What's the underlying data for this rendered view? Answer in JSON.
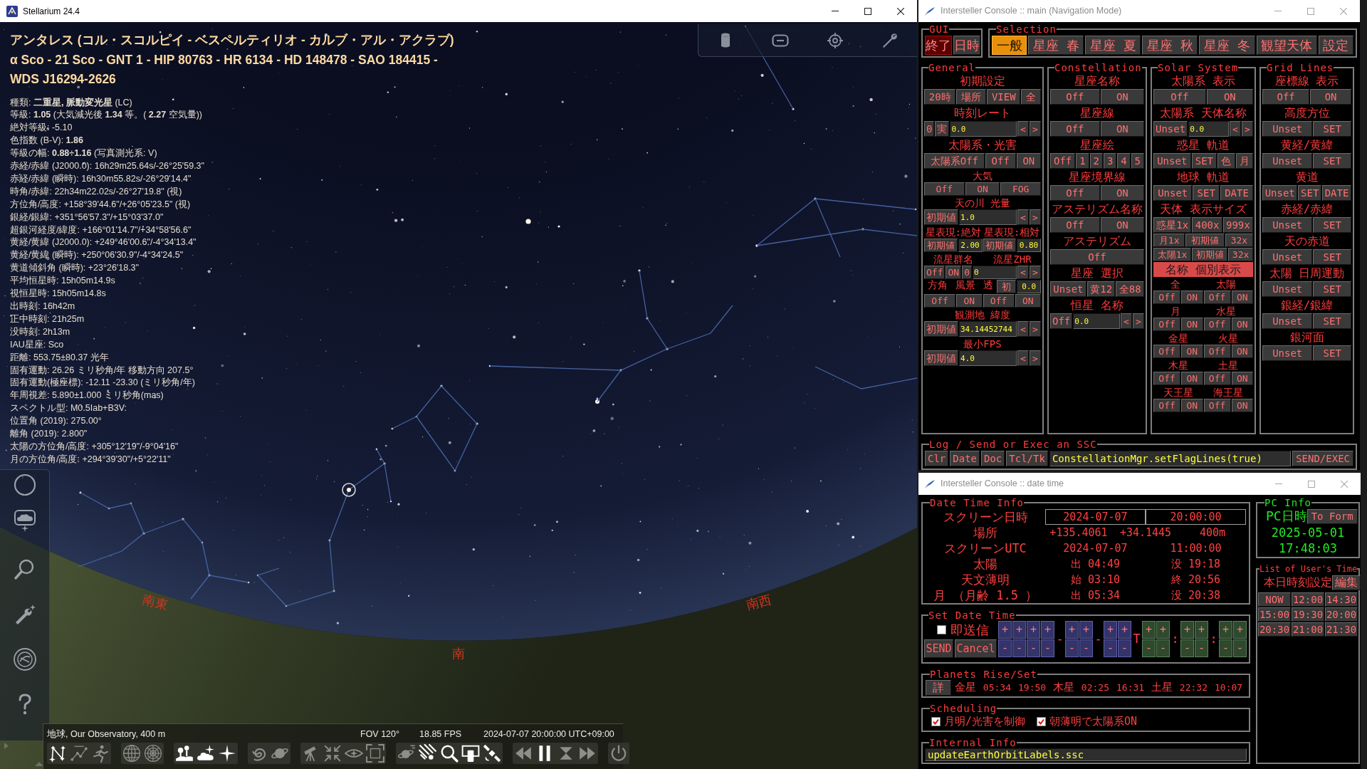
{
  "stellarium": {
    "window": {
      "title": "Stellarium 24.4"
    },
    "info": {
      "title_lines": [
        "アンタレス (コル・スコルピイ - ベスペルティリオ - カルブ・アル・アクラブ)",
        "α Sco - 21 Sco - GNT 1 - HIP 80763 - HR 6134 - HD 148478 - SAO 184415 -",
        "WDS J16294-2626"
      ],
      "lines": [
        "種類: **二重星, 脈動変光星** (LC)",
        "等級: **1.05** (大気減光後 **1.34** 等。( **2.27** 空気量))",
        "絶対等級: -5.10",
        "色指数 (B-V): **1.86**",
        "等級の幅: **0.88÷1.16** (写真測光系: V)",
        "赤経/赤緯 (J2000.0): 16h29m25.64s/-26°25'59.3\"",
        "赤経/赤緯 (瞬時): 16h30m55.82s/-26°29'14.4\"",
        "時角/赤緯: 22h34m22.02s/-26°27'19.8\" (視)",
        "方位角/高度: +158°39'44.6\"/+26°05'23.5\" (視)",
        "銀経/銀緯: +351°56'57.3\"/+15°03'37.0\"",
        "超銀河経度/緯度: +166°01'14.7\"/+34°58'56.6\"",
        "黄経/黄緯 (J2000.0): +249°46'00.6\"/-4°34'13.4\"",
        "黄経/黄緯 (瞬時): +250°06'30.9\"/-4°34'24.5\"",
        "黄道傾斜角 (瞬時): +23°26'18.3\"",
        "平均恒星時: 15h05m14.9s",
        "視恒星時: 15h05m14.8s",
        "出時刻: 16h42m",
        "正中時刻: 21h25m",
        "没時刻: 2h13m",
        "IAU星座: Sco",
        "距離: 553.75±80.37 光年",
        "固有運動: 26.26 ミリ秒角/年 移動方向 207.5°",
        "固有運動(極座標): -12.11 -23.30 (ミリ秒角/年)",
        "年周視差: 5.890±1.000 ミリ秒角(mas)",
        "スペクトル型: M0.5Iab+B3V:",
        "位置角 (2019): 275.00°",
        "離角 (2019): 2.800\"",
        "太陽の方位角/高度: +305°12'19\"/-9°04'16\"",
        "月の方位角/高度: +294°39'30\"/+5°22'11\""
      ]
    },
    "directions": [
      "南東",
      "南",
      "南西"
    ],
    "status": {
      "location": "地球, Our Observatory, 400 m",
      "fov": "FOV 120°",
      "fps": "18.85 FPS",
      "datetime": "2024-07-07 20:00:00 UTC+09:00"
    },
    "toolbar": [
      {
        "buttons": [
          {
            "kind": "lines",
            "on": true
          },
          {
            "kind": "labels",
            "on": false
          },
          {
            "kind": "art",
            "on": false
          }
        ]
      },
      {
        "buttons": [
          {
            "kind": "equatorial",
            "on": false
          },
          {
            "kind": "azimuthal",
            "on": false
          }
        ]
      },
      {
        "buttons": [
          {
            "kind": "ground",
            "on": true
          },
          {
            "kind": "atmosphere",
            "on": true
          },
          {
            "kind": "stars",
            "on": true
          }
        ]
      },
      {
        "buttons": [
          {
            "kind": "nebulae",
            "on": false
          },
          {
            "kind": "planets",
            "on": false
          }
        ]
      },
      {
        "buttons": [
          {
            "kind": "mount",
            "on": false
          },
          {
            "kind": "center",
            "on": false
          },
          {
            "kind": "night",
            "on": false
          },
          {
            "kind": "fullscreen",
            "on": false
          }
        ]
      },
      {
        "buttons": [
          {
            "kind": "planetlabels",
            "on": false
          },
          {
            "kind": "meteors",
            "on": true
          },
          {
            "kind": "search",
            "on": true
          },
          {
            "kind": "remote",
            "on": true
          },
          {
            "kind": "satellites",
            "on": true
          }
        ]
      },
      {
        "buttons": [
          {
            "kind": "rewind",
            "on": false
          },
          {
            "kind": "pause",
            "on": true
          },
          {
            "kind": "realtime",
            "on": false
          },
          {
            "kind": "forward",
            "on": false
          }
        ]
      },
      {
        "buttons": [
          {
            "kind": "quit",
            "on": false
          }
        ]
      }
    ]
  },
  "console_main": {
    "title": "Intersteller Console :: main (Navigation Mode)",
    "gui": {
      "legend": "GUI",
      "buttons": [
        {
          "kind": "exit",
          "text": "終了"
        },
        {
          "kind": "normal",
          "text": "日時"
        }
      ]
    },
    "selection": {
      "legend": "Selection",
      "tabs": [
        {
          "label": "一般",
          "selected": true
        },
        {
          "label": "星座 春",
          "selected": false
        },
        {
          "label": "星座 夏",
          "selected": false
        },
        {
          "label": "星座 秋",
          "selected": false
        },
        {
          "label": "星座 冬",
          "selected": false
        },
        {
          "label": "観望天体",
          "selected": false
        },
        {
          "label": "設定",
          "selected": false
        }
      ]
    },
    "panels": [
      {
        "legend": "General",
        "rows": [
          {
            "kind": "heading",
            "items": [
              {
                "kind": "label",
                "text": "初期設定"
              }
            ]
          },
          {
            "kind": "controls",
            "items": [
              {
                "kind": "button",
                "text": "20時"
              },
              {
                "kind": "button",
                "text": "場所"
              },
              {
                "kind": "button",
                "text": "VIEW"
              },
              {
                "kind": "button",
                "text": "全"
              }
            ]
          },
          {
            "kind": "heading",
            "items": [
              {
                "kind": "label",
                "text": "時刻レート"
              }
            ]
          },
          {
            "kind": "controls",
            "items": [
              {
                "kind": "button",
                "text": "0"
              },
              {
                "kind": "button",
                "text": "実"
              },
              {
                "kind": "field",
                "text": "0.0"
              },
              {
                "kind": "arrow",
                "text": "<"
              },
              {
                "kind": "arrow",
                "text": ">"
              }
            ]
          },
          {
            "kind": "heading",
            "items": [
              {
                "kind": "label",
                "text": "太陽系・光害"
              }
            ]
          },
          {
            "kind": "controls",
            "items": [
              {
                "kind": "button",
                "text": "太陽系Off"
              },
              {
                "kind": "button",
                "text": "Off"
              },
              {
                "kind": "button",
                "text": "ON"
              }
            ]
          },
          {
            "kind": "subheading",
            "items": [
              {
                "kind": "label",
                "text": "大気"
              }
            ]
          },
          {
            "kind": "small",
            "items": [
              {
                "kind": "button",
                "text": "Off"
              },
              {
                "kind": "button",
                "text": "ON"
              },
              {
                "kind": "button",
                "text": "FOG"
              }
            ]
          },
          {
            "kind": "subheading",
            "items": [
              {
                "kind": "label",
                "text": "天の川 光量"
              }
            ]
          },
          {
            "kind": "controls",
            "items": [
              {
                "kind": "button",
                "text": "初期値"
              },
              {
                "kind": "field",
                "text": "1.0"
              },
              {
                "kind": "arrow",
                "text": "<"
              },
              {
                "kind": "arrow",
                "text": ">"
              }
            ]
          },
          {
            "kind": "subheading",
            "items": [
              {
                "kind": "label",
                "text": "星表現:絶対"
              },
              {
                "kind": "label",
                "text": "星表現:相対"
              }
            ]
          },
          {
            "kind": "small",
            "items": [
              {
                "kind": "button",
                "text": "初期値"
              },
              {
                "kind": "value",
                "text": "2.00"
              },
              {
                "kind": "button",
                "text": "初期値"
              },
              {
                "kind": "value",
                "text": "0.80"
              }
            ]
          },
          {
            "kind": "subheading",
            "items": [
              {
                "kind": "label",
                "text": "流星群名"
              },
              {
                "kind": "label",
                "text": "流星ZHR"
              }
            ]
          },
          {
            "kind": "small",
            "items": [
              {
                "kind": "button",
                "text": "Off"
              },
              {
                "kind": "button",
                "text": "ON"
              },
              {
                "kind": "button",
                "text": "0"
              },
              {
                "kind": "field",
                "text": "0"
              },
              {
                "kind": "arrow",
                "text": "<"
              },
              {
                "kind": "arrow",
                "text": ">"
              }
            ]
          },
          {
            "kind": "small",
            "items": [
              {
                "kind": "label",
                "text": "方角"
              },
              {
                "kind": "label",
                "text": "風景"
              },
              {
                "kind": "label",
                "text": "透"
              },
              {
                "kind": "button",
                "text": "初"
              },
              {
                "kind": "value",
                "text": "0.0"
              }
            ]
          },
          {
            "kind": "small",
            "items": [
              {
                "kind": "button",
                "text": "Off"
              },
              {
                "kind": "button",
                "text": "ON"
              },
              {
                "kind": "button",
                "text": "Off"
              },
              {
                "kind": "button",
                "text": "ON"
              }
            ]
          },
          {
            "kind": "subheading",
            "items": [
              {
                "kind": "label",
                "text": "観測地 緯度"
              }
            ]
          },
          {
            "kind": "controls",
            "items": [
              {
                "kind": "button",
                "text": "初期値"
              },
              {
                "kind": "field",
                "text": "34.14452744"
              },
              {
                "kind": "arrow",
                "text": "<"
              },
              {
                "kind": "arrow",
                "text": ">"
              }
            ]
          },
          {
            "kind": "subheading",
            "items": [
              {
                "kind": "label",
                "text": "最小FPS"
              }
            ]
          },
          {
            "kind": "controls",
            "items": [
              {
                "kind": "button",
                "text": "初期値"
              },
              {
                "kind": "field",
                "text": "4.0"
              },
              {
                "kind": "arrow",
                "text": "<"
              },
              {
                "kind": "arrow",
                "text": ">"
              }
            ]
          }
        ]
      },
      {
        "legend": "Constellation",
        "rows": [
          {
            "kind": "heading",
            "items": [
              {
                "kind": "label",
                "text": "星座名称"
              }
            ]
          },
          {
            "kind": "controls",
            "items": [
              {
                "kind": "button",
                "text": "Off"
              },
              {
                "kind": "button",
                "text": "ON"
              }
            ]
          },
          {
            "kind": "heading",
            "items": [
              {
                "kind": "label",
                "text": "星座線"
              }
            ]
          },
          {
            "kind": "controls",
            "items": [
              {
                "kind": "button",
                "text": "Off"
              },
              {
                "kind": "button",
                "text": "ON"
              }
            ]
          },
          {
            "kind": "heading",
            "items": [
              {
                "kind": "label",
                "text": "星座絵"
              }
            ]
          },
          {
            "kind": "controls",
            "items": [
              {
                "kind": "button",
                "text": "Off"
              },
              {
                "kind": "button",
                "text": "1"
              },
              {
                "kind": "button",
                "text": "2"
              },
              {
                "kind": "button",
                "text": "3"
              },
              {
                "kind": "button",
                "text": "4"
              },
              {
                "kind": "button",
                "text": "5"
              }
            ]
          },
          {
            "kind": "heading",
            "items": [
              {
                "kind": "label",
                "text": "星座境界線"
              }
            ]
          },
          {
            "kind": "controls",
            "items": [
              {
                "kind": "button",
                "text": "Off"
              },
              {
                "kind": "button",
                "text": "ON"
              }
            ]
          },
          {
            "kind": "heading",
            "items": [
              {
                "kind": "label",
                "text": "アステリズム名称"
              }
            ]
          },
          {
            "kind": "controls",
            "items": [
              {
                "kind": "button",
                "text": "Off"
              },
              {
                "kind": "button",
                "text": "ON"
              }
            ]
          },
          {
            "kind": "heading",
            "items": [
              {
                "kind": "label",
                "text": "アステリズム"
              }
            ]
          },
          {
            "kind": "controls",
            "items": [
              {
                "kind": "button",
                "text": "Off"
              }
            ]
          },
          {
            "kind": "heading",
            "items": [
              {
                "kind": "label",
                "text": "星座 選択"
              }
            ]
          },
          {
            "kind": "controls",
            "items": [
              {
                "kind": "button",
                "text": "Unset"
              },
              {
                "kind": "button",
                "text": "黄12"
              },
              {
                "kind": "button",
                "text": "全88"
              }
            ]
          },
          {
            "kind": "heading",
            "items": [
              {
                "kind": "label",
                "text": "恒星 名称"
              }
            ]
          },
          {
            "kind": "controls",
            "items": [
              {
                "kind": "button",
                "text": "Off"
              },
              {
                "kind": "field",
                "text": "0.0"
              },
              {
                "kind": "arrow",
                "text": "<"
              },
              {
                "kind": "arrow",
                "text": ">"
              }
            ]
          }
        ]
      },
      {
        "legend": "Solar System",
        "rows": [
          {
            "kind": "heading",
            "items": [
              {
                "kind": "label",
                "text": "太陽系 表示"
              }
            ]
          },
          {
            "kind": "controls",
            "items": [
              {
                "kind": "button",
                "text": "Off"
              },
              {
                "kind": "button",
                "text": "ON"
              }
            ]
          },
          {
            "kind": "heading",
            "items": [
              {
                "kind": "label",
                "text": "太陽系 天体名称"
              }
            ]
          },
          {
            "kind": "controls",
            "items": [
              {
                "kind": "button",
                "text": "Unset"
              },
              {
                "kind": "field",
                "text": "0.0"
              },
              {
                "kind": "arrow",
                "text": "<"
              },
              {
                "kind": "arrow",
                "text": ">"
              }
            ]
          },
          {
            "kind": "heading",
            "items": [
              {
                "kind": "label",
                "text": "惑星 軌道"
              }
            ]
          },
          {
            "kind": "controls",
            "items": [
              {
                "kind": "button",
                "text": "Unset"
              },
              {
                "kind": "button",
                "text": "SET"
              },
              {
                "kind": "button",
                "text": "色"
              },
              {
                "kind": "button",
                "text": "月"
              }
            ]
          },
          {
            "kind": "heading",
            "items": [
              {
                "kind": "label",
                "text": "地球 軌道"
              }
            ]
          },
          {
            "kind": "controls",
            "items": [
              {
                "kind": "button",
                "text": "Unset"
              },
              {
                "kind": "button",
                "text": "SET"
              },
              {
                "kind": "button",
                "text": "DATE"
              }
            ]
          },
          {
            "kind": "heading",
            "items": [
              {
                "kind": "label",
                "text": "天体 表示サイズ"
              }
            ]
          },
          {
            "kind": "controls",
            "items": [
              {
                "kind": "button",
                "text": "惑星1x"
              },
              {
                "kind": "button",
                "text": "400x"
              },
              {
                "kind": "button",
                "text": "999x"
              }
            ]
          },
          {
            "kind": "small",
            "items": [
              {
                "kind": "button",
                "text": "月1x"
              },
              {
                "kind": "button",
                "text": "初期値"
              },
              {
                "kind": "button",
                "text": "32x"
              }
            ]
          },
          {
            "kind": "small",
            "items": [
              {
                "kind": "button",
                "text": "太陽1x"
              },
              {
                "kind": "button",
                "text": "初期値"
              },
              {
                "kind": "button",
                "text": "32x"
              }
            ]
          },
          {
            "kind": "banner",
            "items": [
              {
                "kind": "banner",
                "text": "名称 個別表示"
              }
            ]
          },
          {
            "kind": "subheading",
            "items": [
              {
                "kind": "label",
                "text": "全"
              },
              {
                "kind": "label",
                "text": "太陽"
              }
            ]
          },
          {
            "kind": "small",
            "items": [
              {
                "kind": "button",
                "text": "Off"
              },
              {
                "kind": "button",
                "text": "ON"
              },
              {
                "kind": "button",
                "text": "Off"
              },
              {
                "kind": "button",
                "text": "ON"
              }
            ]
          },
          {
            "kind": "subheading",
            "items": [
              {
                "kind": "label",
                "text": "月"
              },
              {
                "kind": "label",
                "text": "水星"
              }
            ]
          },
          {
            "kind": "small",
            "items": [
              {
                "kind": "button",
                "text": "Off"
              },
              {
                "kind": "button",
                "text": "ON"
              },
              {
                "kind": "button",
                "text": "Off"
              },
              {
                "kind": "button",
                "text": "ON"
              }
            ]
          },
          {
            "kind": "subheading",
            "items": [
              {
                "kind": "label",
                "text": "金星"
              },
              {
                "kind": "label",
                "text": "火星"
              }
            ]
          },
          {
            "kind": "small",
            "items": [
              {
                "kind": "button",
                "text": "Off"
              },
              {
                "kind": "button",
                "text": "ON"
              },
              {
                "kind": "button",
                "text": "Off"
              },
              {
                "kind": "button",
                "text": "ON"
              }
            ]
          },
          {
            "kind": "subheading",
            "items": [
              {
                "kind": "label",
                "text": "木星"
              },
              {
                "kind": "label",
                "text": "土星"
              }
            ]
          },
          {
            "kind": "small",
            "items": [
              {
                "kind": "button",
                "text": "Off"
              },
              {
                "kind": "button",
                "text": "ON"
              },
              {
                "kind": "button",
                "text": "Off"
              },
              {
                "kind": "button",
                "text": "ON"
              }
            ]
          },
          {
            "kind": "subheading",
            "items": [
              {
                "kind": "label",
                "text": "天王星"
              },
              {
                "kind": "label",
                "text": "海王星"
              }
            ]
          },
          {
            "kind": "small",
            "items": [
              {
                "kind": "button",
                "text": "Off"
              },
              {
                "kind": "button",
                "text": "ON"
              },
              {
                "kind": "button",
                "text": "Off"
              },
              {
                "kind": "button",
                "text": "ON"
              }
            ]
          }
        ]
      },
      {
        "legend": "Grid Lines",
        "rows": [
          {
            "kind": "heading",
            "items": [
              {
                "kind": "label",
                "text": "座標線 表示"
              }
            ]
          },
          {
            "kind": "controls",
            "items": [
              {
                "kind": "button",
                "text": "Off"
              },
              {
                "kind": "button",
                "text": "ON"
              }
            ]
          },
          {
            "kind": "heading",
            "items": [
              {
                "kind": "label",
                "text": "高度方位"
              }
            ]
          },
          {
            "kind": "controls",
            "items": [
              {
                "kind": "button",
                "text": "Unset"
              },
              {
                "kind": "button",
                "text": "SET"
              }
            ]
          },
          {
            "kind": "heading",
            "items": [
              {
                "kind": "label",
                "text": "黄経/黄緯"
              }
            ]
          },
          {
            "kind": "controls",
            "items": [
              {
                "kind": "button",
                "text": "Unset"
              },
              {
                "kind": "button",
                "text": "SET"
              }
            ]
          },
          {
            "kind": "heading",
            "items": [
              {
                "kind": "label",
                "text": "黄道"
              }
            ]
          },
          {
            "kind": "controls",
            "items": [
              {
                "kind": "button",
                "text": "Unset"
              },
              {
                "kind": "button",
                "text": "SET"
              },
              {
                "kind": "button",
                "text": "DATE"
              }
            ]
          },
          {
            "kind": "heading",
            "items": [
              {
                "kind": "label",
                "text": "赤経/赤緯"
              }
            ]
          },
          {
            "kind": "controls",
            "items": [
              {
                "kind": "button",
                "text": "Unset"
              },
              {
                "kind": "button",
                "text": "SET"
              }
            ]
          },
          {
            "kind": "heading",
            "items": [
              {
                "kind": "label",
                "text": "天の赤道"
              }
            ]
          },
          {
            "kind": "controls",
            "items": [
              {
                "kind": "button",
                "text": "Unset"
              },
              {
                "kind": "button",
                "text": "SET"
              }
            ]
          },
          {
            "kind": "heading",
            "items": [
              {
                "kind": "label",
                "text": "太陽 日周運動"
              }
            ]
          },
          {
            "kind": "controls",
            "items": [
              {
                "kind": "button",
                "text": "Unset"
              },
              {
                "kind": "button",
                "text": "SET"
              }
            ]
          },
          {
            "kind": "heading",
            "items": [
              {
                "kind": "label",
                "text": "銀経/銀緯"
              }
            ]
          },
          {
            "kind": "controls",
            "items": [
              {
                "kind": "button",
                "text": "Unset"
              },
              {
                "kind": "button",
                "text": "SET"
              }
            ]
          },
          {
            "kind": "heading",
            "items": [
              {
                "kind": "label",
                "text": "銀河面"
              }
            ]
          },
          {
            "kind": "controls",
            "items": [
              {
                "kind": "button",
                "text": "Unset"
              },
              {
                "kind": "button",
                "text": "SET"
              }
            ]
          }
        ]
      }
    ],
    "log": {
      "legend": "Log / Send or Exec an SSC",
      "buttons": [
        "Clr",
        "Date",
        "Doc",
        "Tcl/Tk"
      ],
      "command": "ConstellationMgr.setFlagLines(true)",
      "send": "SEND/EXEC"
    }
  },
  "console_datetime": {
    "title": "Intersteller Console :: date time",
    "info": {
      "legend": "Date Time Info",
      "rows": [
        {
          "kind": "boxed",
          "label": "スクリーン日時",
          "values": [
            "2024-07-07",
            "20:00:00"
          ]
        },
        {
          "kind": "plain",
          "label": "場所",
          "values": [
            "+135.4061",
            "+34.1445",
            "400m"
          ]
        },
        {
          "kind": "plain",
          "label": "スクリーンUTC",
          "values": [
            "2024-07-07",
            "11:00:00"
          ]
        },
        {
          "kind": "plain",
          "label": "太陽",
          "values": [
            "出 04:49",
            "没 19:18"
          ]
        },
        {
          "kind": "plain",
          "label": "天文薄明",
          "values": [
            "始 03:10",
            "終 20:56"
          ]
        },
        {
          "kind": "plain",
          "label": "月 （月齢 1.5 ）",
          "values": [
            "出 05:34",
            "没 20:38"
          ]
        }
      ]
    },
    "set": {
      "legend": "Set Date Time",
      "instant": {
        "label": "即送信",
        "checked": false
      },
      "buttons": [
        "SEND",
        "Cancel"
      ],
      "parts": [
        {
          "kind": "date",
          "up": [
            "+",
            "+",
            "+",
            "+"
          ],
          "down": [
            "-",
            "-",
            "-",
            "-"
          ]
        },
        {
          "kind": "separator",
          "text": "-"
        },
        {
          "kind": "date",
          "up": [
            "+",
            "+"
          ],
          "down": [
            "-",
            "-"
          ]
        },
        {
          "kind": "separator",
          "text": "-"
        },
        {
          "kind": "date",
          "up": [
            "+",
            "+"
          ],
          "down": [
            "-",
            "-"
          ]
        },
        {
          "kind": "separator",
          "text": "T"
        },
        {
          "kind": "time",
          "up": [
            "+",
            "+"
          ],
          "down": [
            "-",
            "-"
          ]
        },
        {
          "kind": "separator",
          "text": ":"
        },
        {
          "kind": "time",
          "up": [
            "+",
            "+"
          ],
          "down": [
            "-",
            "-"
          ]
        },
        {
          "kind": "separator",
          "text": ":"
        },
        {
          "kind": "time",
          "up": [
            "+",
            "+"
          ],
          "down": [
            "-",
            "-"
          ]
        }
      ]
    },
    "planets": {
      "legend": "Planets Rise/Set",
      "button": "詳",
      "items": [
        {
          "name": "金星",
          "rise": "05:34",
          "set": "19:50"
        },
        {
          "name": "木星",
          "rise": "02:25",
          "set": "16:31"
        },
        {
          "name": "土星",
          "rise": "22:32",
          "set": "10:07"
        }
      ]
    },
    "scheduling": {
      "legend": "Scheduling",
      "options": [
        {
          "label": "月明/光害を制御",
          "checked": true
        },
        {
          "label": "朝薄明で太陽系ON",
          "checked": true
        }
      ]
    },
    "internal": {
      "legend": "Internal Info",
      "value": "updateEarthOrbitLabels.ssc"
    },
    "pc": {
      "legend": "PC Info",
      "label": "PC日時",
      "button": "To Form",
      "date": "2025-05-01",
      "time": "17:48:03"
    },
    "user_times": {
      "legend": "List of User's Time",
      "label": "本日時刻設定",
      "button": "編集",
      "times": [
        "NOW",
        "12:00",
        "14:30",
        "15:00",
        "19:30",
        "20:00",
        "20:30",
        "21:00",
        "21:30"
      ]
    }
  }
}
